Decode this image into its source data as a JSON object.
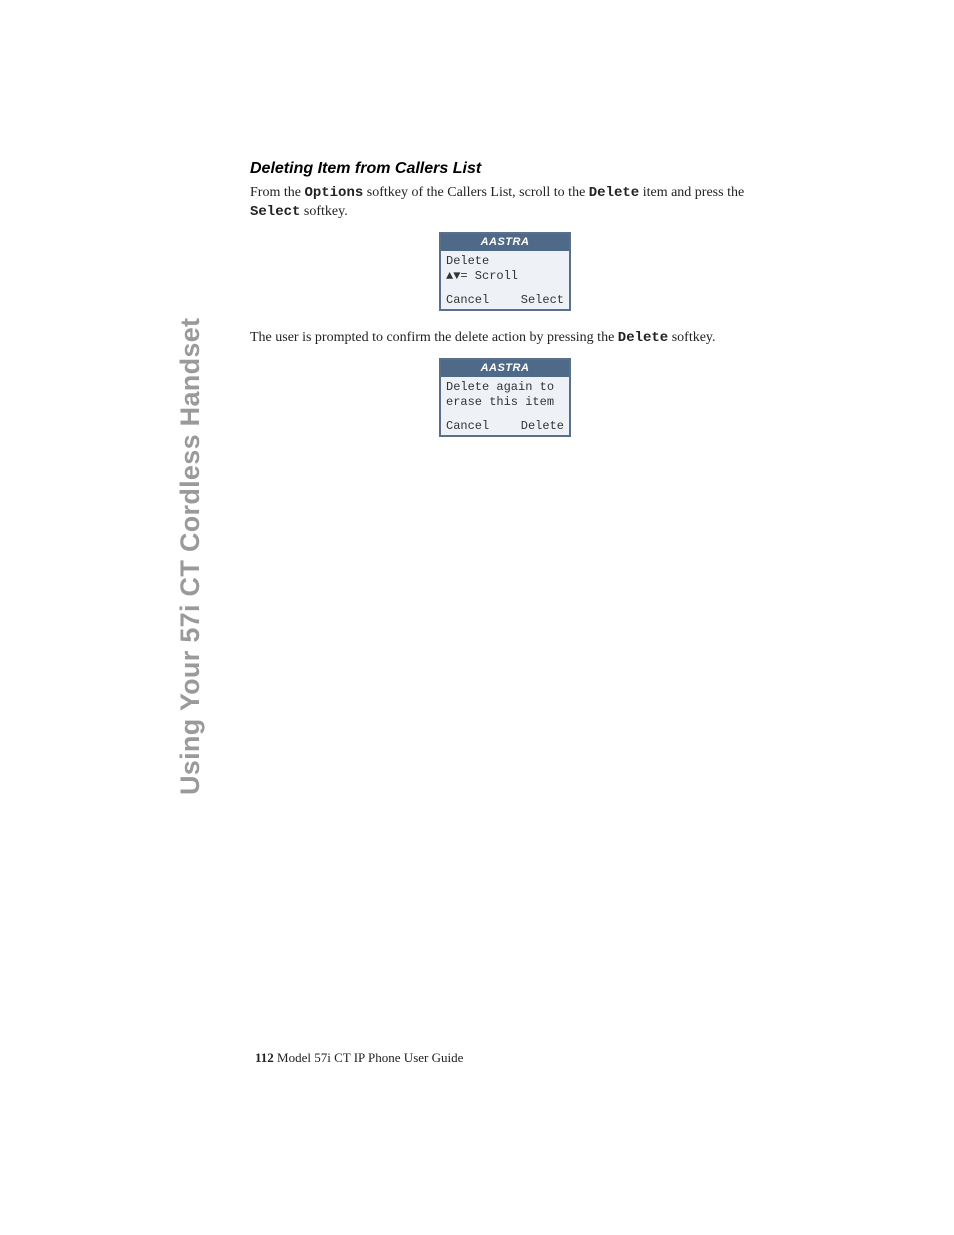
{
  "side_title": "Using Your 57i CT Cordless Handset",
  "heading": "Deleting Item from Callers List",
  "para1_a": "From the ",
  "para1_mono1": "Options",
  "para1_b": " softkey of the Callers List, scroll to the ",
  "para1_mono2": "Delete",
  "para1_c": " item and press the ",
  "para1_mono3": "Select",
  "para1_d": " softkey.",
  "phone_brand": "AASTRA",
  "screen1": {
    "line1": "Delete",
    "line2": "▲▼= Scroll",
    "soft_left": "Cancel",
    "soft_right": "Select"
  },
  "para2_a": "The user is prompted to confirm the delete action by pressing the ",
  "para2_mono1": "Delete",
  "para2_b": " softkey.",
  "screen2": {
    "line1": "Delete again to",
    "line2": "erase this item",
    "soft_left": "Cancel",
    "soft_right": "Delete"
  },
  "footer_page": "112",
  "footer_text": " Model 57i CT IP Phone User Guide"
}
